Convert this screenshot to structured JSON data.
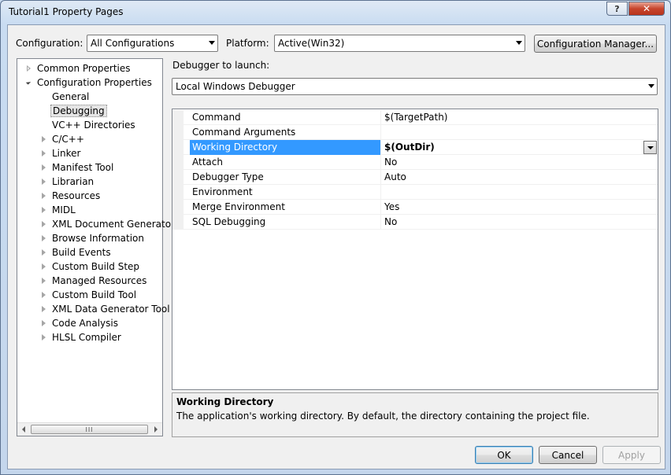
{
  "window": {
    "title": "Tutorial1 Property Pages",
    "help_glyph": "?",
    "close_glyph": "✕"
  },
  "toolbar": {
    "configuration_label": "Configuration:",
    "configuration_value": "All Configurations",
    "platform_label": "Platform:",
    "platform_value": "Active(Win32)",
    "config_manager_label": "Configuration Manager..."
  },
  "tree": {
    "items": [
      {
        "label": "Common Properties",
        "level": 0,
        "state": "closed-hollow"
      },
      {
        "label": "Configuration Properties",
        "level": 0,
        "state": "open"
      },
      {
        "label": "General",
        "level": 1,
        "state": "leaf"
      },
      {
        "label": "Debugging",
        "level": 1,
        "state": "leaf",
        "selected": true
      },
      {
        "label": "VC++ Directories",
        "level": 1,
        "state": "leaf"
      },
      {
        "label": "C/C++",
        "level": 1,
        "state": "closed"
      },
      {
        "label": "Linker",
        "level": 1,
        "state": "closed"
      },
      {
        "label": "Manifest Tool",
        "level": 1,
        "state": "closed"
      },
      {
        "label": "Librarian",
        "level": 1,
        "state": "closed"
      },
      {
        "label": "Resources",
        "level": 1,
        "state": "closed"
      },
      {
        "label": "MIDL",
        "level": 1,
        "state": "closed"
      },
      {
        "label": "XML Document Generator",
        "level": 1,
        "state": "closed"
      },
      {
        "label": "Browse Information",
        "level": 1,
        "state": "closed"
      },
      {
        "label": "Build Events",
        "level": 1,
        "state": "closed"
      },
      {
        "label": "Custom Build Step",
        "level": 1,
        "state": "closed"
      },
      {
        "label": "Managed Resources",
        "level": 1,
        "state": "closed"
      },
      {
        "label": "Custom Build Tool",
        "level": 1,
        "state": "closed"
      },
      {
        "label": "XML Data Generator Tool",
        "level": 1,
        "state": "closed"
      },
      {
        "label": "Code Analysis",
        "level": 1,
        "state": "closed"
      },
      {
        "label": "HLSL Compiler",
        "level": 1,
        "state": "closed"
      }
    ],
    "scroll_thumb_grip": "III"
  },
  "debugger": {
    "label": "Debugger to launch:",
    "value": "Local Windows Debugger"
  },
  "properties": [
    {
      "name": "Command",
      "value": "$(TargetPath)"
    },
    {
      "name": "Command Arguments",
      "value": ""
    },
    {
      "name": "Working Directory",
      "value": "$(OutDir)",
      "selected": true
    },
    {
      "name": "Attach",
      "value": "No"
    },
    {
      "name": "Debugger Type",
      "value": "Auto"
    },
    {
      "name": "Environment",
      "value": ""
    },
    {
      "name": "Merge Environment",
      "value": "Yes"
    },
    {
      "name": "SQL Debugging",
      "value": "No"
    }
  ],
  "description": {
    "title": "Working Directory",
    "text": "The application's working directory. By default, the directory containing the project file."
  },
  "buttons": {
    "ok": "OK",
    "cancel": "Cancel",
    "apply": "Apply"
  },
  "colors": {
    "selection": "#3399ff",
    "close_button": "#c7452d"
  }
}
